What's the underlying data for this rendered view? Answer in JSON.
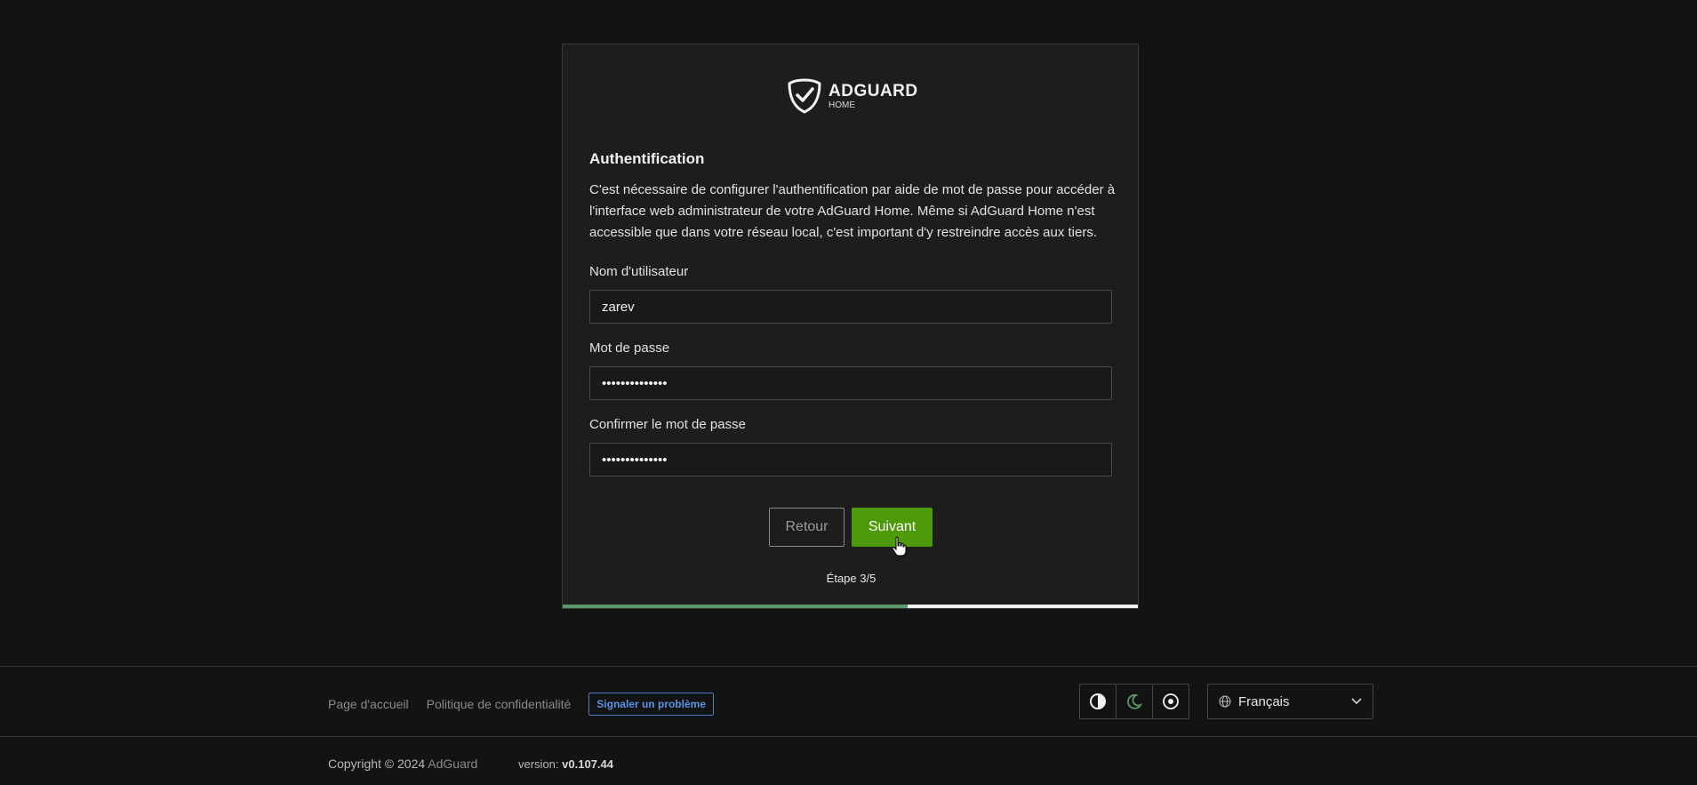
{
  "logo": {
    "name": "ADGUARD",
    "sub": "HOME"
  },
  "auth": {
    "title": "Authentification",
    "description": "C'est nécessaire de configurer l'authentification par aide de mot de passe pour accéder à l'interface web administrateur de votre AdGuard Home. Même si AdGuard Home n'est accessible que dans votre réseau local, c'est important d'y restreindre accès aux tiers.",
    "username_label": "Nom d'utilisateur",
    "username_value": "zarev",
    "password_label": "Mot de passe",
    "password_value": "••••••••••••••",
    "confirm_label": "Confirmer le mot de passe",
    "confirm_value": "••••••••••••••",
    "back_label": "Retour",
    "next_label": "Suivant",
    "step_text": "Étape 3/5",
    "progress": 0.6
  },
  "footer": {
    "home_link": "Page d'accueil",
    "privacy_link": "Politique de confidentialité",
    "report_button": "Signaler un problème",
    "language": "Français",
    "copyright_prefix": "Copyright © 2024",
    "copyright_brand": "AdGuard",
    "version_label": "version:",
    "version_value": "v0.107.44"
  },
  "colors": {
    "accent": "#4d9a0b",
    "link": "#5b93e6",
    "progress": "#5a9a6a"
  }
}
